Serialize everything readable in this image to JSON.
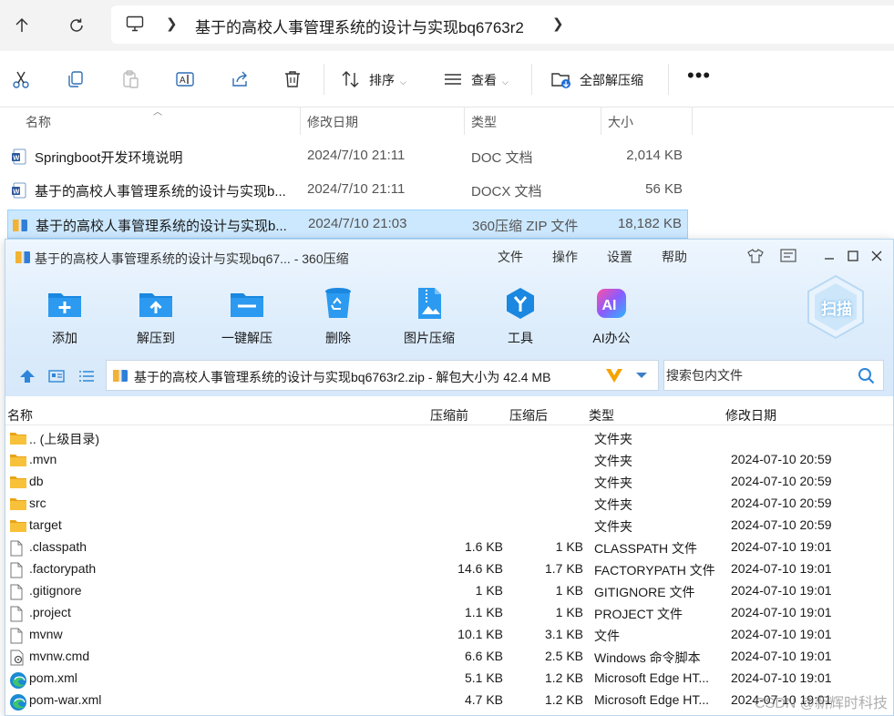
{
  "explorer": {
    "breadcrumb": "基于的高校人事管理系统的设计与实现bq6763r2",
    "toolbar": {
      "sort_label": "排序",
      "view_label": "查看",
      "extract_all_label": "全部解压缩"
    },
    "columns": {
      "name": "名称",
      "modified": "修改日期",
      "type": "类型",
      "size": "大小"
    },
    "files": [
      {
        "name": "Springboot开发环境说明",
        "date": "2024/7/10 21:11",
        "type": "DOC 文档",
        "size": "2,014 KB"
      },
      {
        "name": "基于的高校人事管理系统的设计与实现b...",
        "date": "2024/7/10 21:11",
        "type": "DOCX 文档",
        "size": "56 KB"
      },
      {
        "name": "基于的高校人事管理系统的设计与实现b...",
        "date": "2024/7/10 21:03",
        "type": "360压缩 ZIP 文件",
        "size": "18,182 KB"
      }
    ]
  },
  "zipwin": {
    "title": "基于的高校人事管理系统的设计与实现bq67... - 360压缩",
    "menu": [
      "文件",
      "操作",
      "设置",
      "帮助"
    ],
    "tools": [
      "添加",
      "解压到",
      "一键解压",
      "删除",
      "图片压缩",
      "工具",
      "AI办公"
    ],
    "scan_label": "扫描",
    "path": "基于的高校人事管理系统的设计与实现bq6763r2.zip - 解包大小为 42.4 MB",
    "search_placeholder": "搜索包内文件",
    "columns": {
      "name": "名称",
      "before": "压缩前",
      "after": "压缩后",
      "type": "类型",
      "modified": "修改日期"
    },
    "entries": [
      {
        "icon": "folder",
        "name": ".. (上级目录)",
        "before": "",
        "after": "",
        "type": "文件夹",
        "date": ""
      },
      {
        "icon": "folder",
        "name": ".mvn",
        "before": "",
        "after": "",
        "type": "文件夹",
        "date": "2024-07-10 20:59"
      },
      {
        "icon": "folder",
        "name": "db",
        "before": "",
        "after": "",
        "type": "文件夹",
        "date": "2024-07-10 20:59"
      },
      {
        "icon": "folder",
        "name": "src",
        "before": "",
        "after": "",
        "type": "文件夹",
        "date": "2024-07-10 20:59"
      },
      {
        "icon": "folder",
        "name": "target",
        "before": "",
        "after": "",
        "type": "文件夹",
        "date": "2024-07-10 20:59"
      },
      {
        "icon": "file",
        "name": ".classpath",
        "before": "1.6 KB",
        "after": "1 KB",
        "type": "CLASSPATH 文件",
        "date": "2024-07-10 19:01"
      },
      {
        "icon": "file",
        "name": ".factorypath",
        "before": "14.6 KB",
        "after": "1.7 KB",
        "type": "FACTORYPATH 文件",
        "date": "2024-07-10 19:01"
      },
      {
        "icon": "file",
        "name": ".gitignore",
        "before": "1 KB",
        "after": "1 KB",
        "type": "GITIGNORE 文件",
        "date": "2024-07-10 19:01"
      },
      {
        "icon": "file",
        "name": ".project",
        "before": "1.1 KB",
        "after": "1 KB",
        "type": "PROJECT 文件",
        "date": "2024-07-10 19:01"
      },
      {
        "icon": "file",
        "name": "mvnw",
        "before": "10.1 KB",
        "after": "3.1 KB",
        "type": "文件",
        "date": "2024-07-10 19:01"
      },
      {
        "icon": "cmd",
        "name": "mvnw.cmd",
        "before": "6.6 KB",
        "after": "2.5 KB",
        "type": "Windows 命令脚本",
        "date": "2024-07-10 19:01"
      },
      {
        "icon": "edge",
        "name": "pom.xml",
        "before": "5.1 KB",
        "after": "1.2 KB",
        "type": "Microsoft Edge HT...",
        "date": "2024-07-10 19:01"
      },
      {
        "icon": "edge",
        "name": "pom-war.xml",
        "before": "4.7 KB",
        "after": "1.2 KB",
        "type": "Microsoft Edge HT...",
        "date": "2024-07-10 19:01"
      }
    ]
  },
  "watermark": "CSDN @新辉时科技"
}
